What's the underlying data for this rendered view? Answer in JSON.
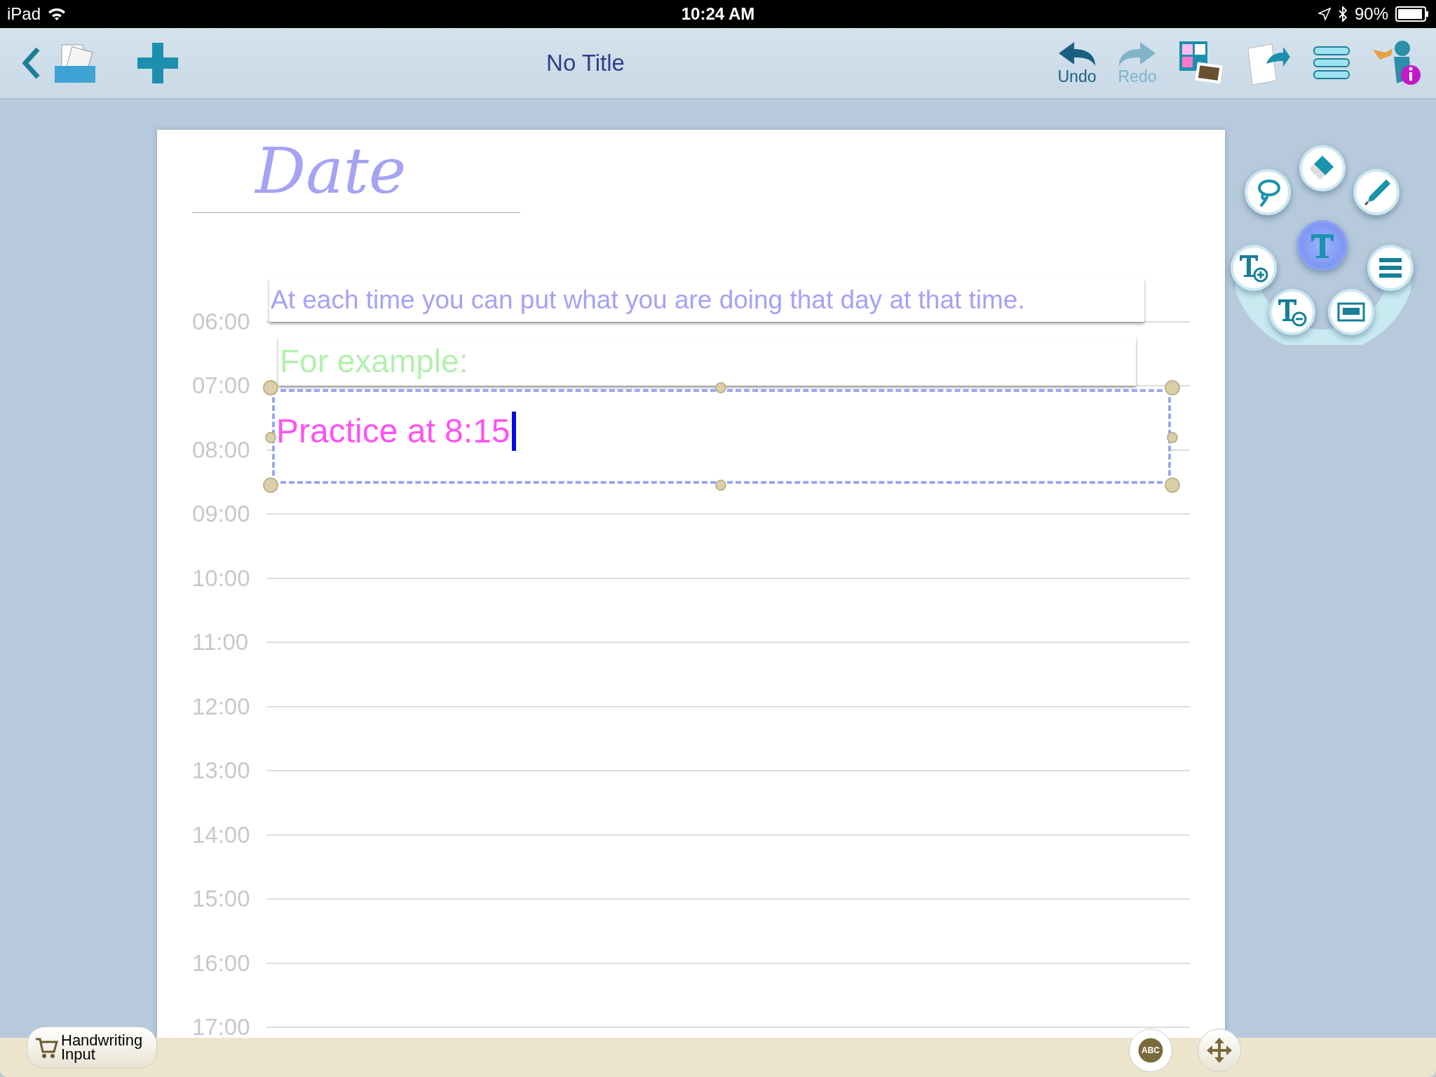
{
  "status_bar": {
    "device": "iPad",
    "time": "10:24 AM",
    "battery": "90%"
  },
  "toolbar": {
    "title": "No Title",
    "undo": {
      "label": "Undo",
      "disabled": false
    },
    "redo": {
      "label": "Redo",
      "disabled": true
    }
  },
  "page": {
    "heading": "Date",
    "times": [
      "06:00",
      "07:00",
      "08:00",
      "09:00",
      "10:00",
      "11:00",
      "12:00",
      "13:00",
      "14:00",
      "15:00",
      "16:00",
      "17:00"
    ],
    "text_boxes": [
      {
        "text": "At each time you can put what you are doing that day at that time.",
        "color": "#a6a2f4",
        "selected": false
      },
      {
        "text": "For example:",
        "color": "#b4f0ae",
        "selected": false
      },
      {
        "text": "Practice at 8:15",
        "color": "#ff52f4",
        "selected": true
      }
    ]
  },
  "tools": [
    {
      "kind": "lasso",
      "selected": false
    },
    {
      "kind": "eraser",
      "selected": false
    },
    {
      "kind": "pen",
      "selected": false
    },
    {
      "kind": "text",
      "selected": true
    },
    {
      "kind": "text-add",
      "selected": false
    },
    {
      "kind": "menu",
      "selected": false
    },
    {
      "kind": "text-remove",
      "selected": false
    },
    {
      "kind": "keyboard",
      "selected": false
    }
  ],
  "bottom_bar": {
    "handwriting_button": "Handwriting Input",
    "abc_label": "ABC"
  }
}
